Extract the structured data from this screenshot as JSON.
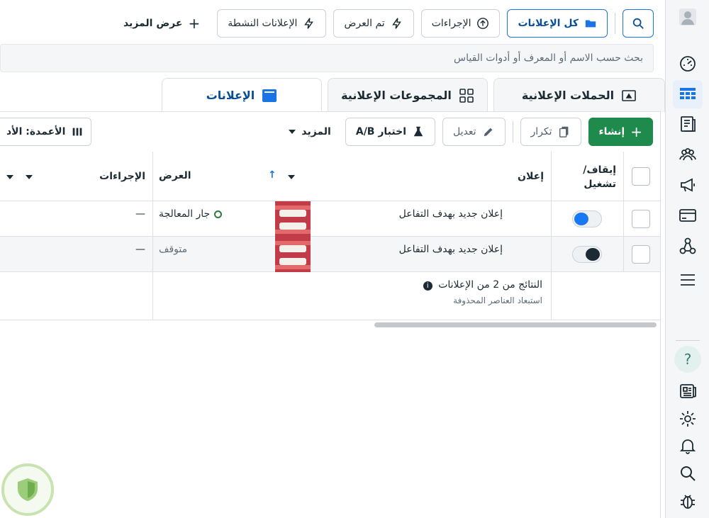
{
  "topbar": {
    "all_ads": "كل الإعلانات",
    "actions": "الإجراءات",
    "delivered": "تم العرض",
    "active_ads": "الإعلانات النشطة",
    "show_more": "عرض المزيد"
  },
  "search": {
    "placeholder": "بحث حسب الاسم أو المعرف أو أدوات القياس"
  },
  "tabs": [
    {
      "label": "الحملات الإعلانية"
    },
    {
      "label": "المجموعات الإعلانية"
    },
    {
      "label": "الإعلانات"
    }
  ],
  "toolbar": {
    "create": "إنشاء",
    "duplicate": "تكرار",
    "edit": "تعديل",
    "ab_test": "اختبار A/B",
    "more": "المزيد",
    "columns": "الأعمدة: الأد"
  },
  "table": {
    "headers": {
      "toggle": "إيقاف/ تشغيل",
      "ad": "إعلان",
      "delivery": "العرض",
      "actions": "الإجراءات"
    },
    "rows": [
      {
        "name": "إعلان جديد بهدف التفاعل",
        "status": "جار المعالجة",
        "actions": "—",
        "on": true
      },
      {
        "name": "إعلان جديد بهدف التفاعل",
        "status": "متوقف",
        "actions": "—",
        "on": false
      }
    ],
    "summary": {
      "title": "النتائج من 2 من الإعلانات",
      "subtitle": "استبعاد العناصر المحذوفة"
    }
  },
  "colors": {
    "primary": "#1b74e4",
    "create": "#1e8a4c",
    "toggle_on": "#1877f2",
    "toggle_off": "#1c2b33"
  }
}
